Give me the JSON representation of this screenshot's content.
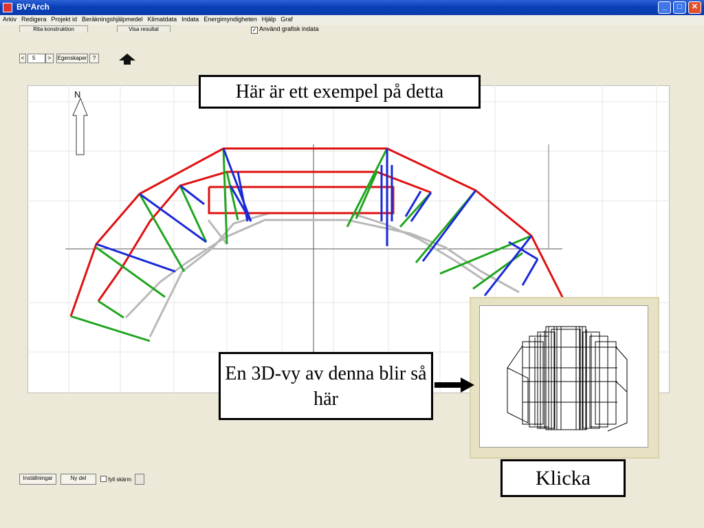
{
  "window": {
    "title": "BV²Arch"
  },
  "menu": [
    "Arkiv",
    "Redigera",
    "Projekt id",
    "Beräkningshjälpmedel",
    "Klimatdata",
    "Indata",
    "Energimyndigheten",
    "Hjälp",
    "Graf"
  ],
  "tabs": {
    "draw": "Rita konstruktion",
    "results": "Visa resultat"
  },
  "toolbar": {
    "prev": "<",
    "page_value": "5",
    "next": ">",
    "properties": "Egenskaper",
    "help": "?",
    "graphic_input_label": "Använd grafisk indata",
    "graphic_input_checked": true
  },
  "canvas": {
    "north_label": "N"
  },
  "bottom": {
    "settings": "Inställningar",
    "new_part": "Ny del",
    "fill_screen": "fyll skärm"
  },
  "callouts": {
    "example": "Här är ett exempel på detta",
    "view3d": "En 3D-vy av denna blir så här",
    "click": "Klicka"
  },
  "colors": {
    "outer": "#e01010",
    "middle": "#1fa51f",
    "inner": "#1a28d8",
    "base": "#b8b8b8"
  }
}
